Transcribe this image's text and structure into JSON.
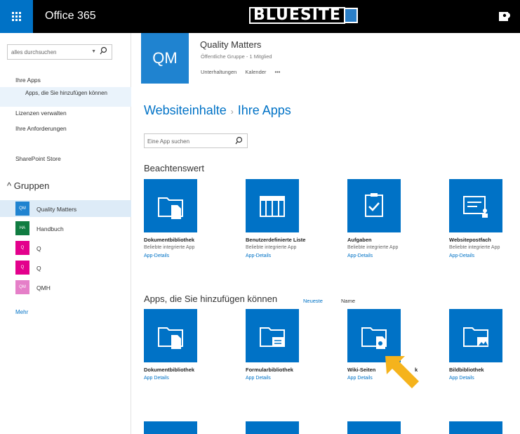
{
  "topbar": {
    "brand": "Office 365",
    "logo": "BLUESITE",
    "waffle_icon": "waffle-icon",
    "user_icon": "user-icon"
  },
  "leftnav": {
    "search_placeholder": "alles durchsuchen",
    "links": {
      "ihre_apps": "Ihre Apps",
      "apps_hinzufuegen": "Apps, die Sie hinzufügen können",
      "lizenzen": "Lizenzen verwalten",
      "anforderungen": "Ihre Anforderungen",
      "store": "SharePoint Store"
    },
    "groups_heading": "Gruppen",
    "groups": [
      {
        "badge": "QM",
        "name": "Quality Matters",
        "color": "#1f83d0"
      },
      {
        "badge": "HA",
        "name": "Handbuch",
        "color": "#107c41"
      },
      {
        "badge": "Q",
        "name": "Q",
        "color": "#e3008c"
      },
      {
        "badge": "Q",
        "name": "Q",
        "color": "#e3008c"
      },
      {
        "badge": "QM",
        "name": "QMH",
        "color": "#e57fc8"
      }
    ],
    "more": "Mehr"
  },
  "group_header": {
    "tile": "QM",
    "title": "Quality Matters",
    "subtitle": "Öffentliche Gruppe - 1 Mitglied",
    "link_conversations": "Unterhaltungen",
    "link_calendar": "Kalender",
    "link_more": "•••"
  },
  "page_title": {
    "part1": "Websiteinhalte",
    "sep": "›",
    "part2": "Ihre Apps"
  },
  "app_search_placeholder": "Eine App suchen",
  "noteworthy": {
    "heading": "Beachtenswert",
    "apps": [
      {
        "name": "Dokumentbibliothek",
        "desc": "Beliebte integrierte App",
        "details": "App-Details"
      },
      {
        "name": "Benutzerdefinierte Liste",
        "desc": "Beliebte integrierte App",
        "details": "App-Details"
      },
      {
        "name": "Aufgaben",
        "desc": "Beliebte integrierte App",
        "details": "App-Details"
      },
      {
        "name": "Websitepostfach",
        "desc": "Beliebte integrierte App",
        "details": "App-Details"
      }
    ]
  },
  "addable": {
    "heading": "Apps, die Sie hinzufügen können",
    "sort_newest": "Neueste",
    "sort_name": "Name",
    "apps": [
      {
        "name": "Dokumentbibliothek",
        "details": "App Details"
      },
      {
        "name": "Formularbibliothek",
        "details": "App Details"
      },
      {
        "name": "Wiki-Seiten",
        "name_tail": "k",
        "details": "App Details"
      },
      {
        "name": "Bildbibliothek",
        "details": "App Details"
      }
    ]
  },
  "colors": {
    "accent": "#0072c6",
    "arrow": "#f5b31c"
  }
}
